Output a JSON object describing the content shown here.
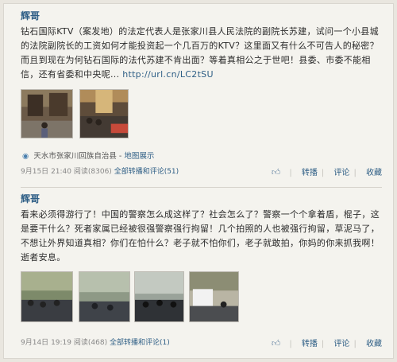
{
  "post1": {
    "author": "辉哥",
    "text": "钻石国际KTV（案发地）的法定代表人是张家川县人民法院的副院长苏建，试问一个小县城的法院副院长的工资如何才能投资起一个几百万的KTV？这里面又有什么不可告人的秘密？而且到现在为何钻石国际的法代苏建不肯出面？等着真相公之于世吧！县委、市委不能相信，还有省委和中央呢...",
    "link": "http://url.cn/LC2tSU",
    "location": "天水市张家川回族自治县",
    "map_link": "地图展示",
    "date": "9月15日",
    "time": "21:40",
    "reads": "阅读(8306)",
    "comments_link": "全部转播和评论(51)",
    "actions": [
      "转播",
      "评论",
      "收藏"
    ]
  },
  "post2": {
    "author": "辉哥",
    "text": "看来必须得游行了！中国的警察怎么成这样了？社会怎么了？警察一个个拿着盾，棍子，这是要干什么？死者家属已经被很强警察强行拘留！几个拍照的人也被强行拘留，草泥马了，不想让外界知道真相？你们在怕什么？老子就不怕你们，老子就敢拍，你妈的你来抓我啊！逝者安息。",
    "date": "9月14日",
    "time": "19:19",
    "reads": "阅读(468)",
    "comments_link": "全部转播和评论(1)",
    "actions": [
      "转播",
      "评论",
      "收藏"
    ]
  },
  "icons": {
    "like": "thumbs-up-icon",
    "location": "map-pin-icon"
  }
}
